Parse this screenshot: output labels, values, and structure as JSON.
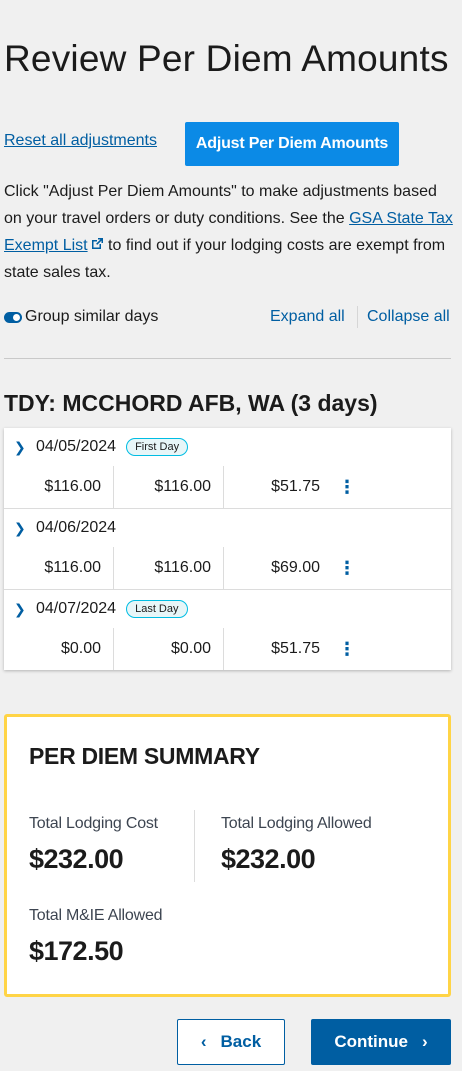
{
  "page": {
    "title": "Review Per Diem Amounts"
  },
  "actions": {
    "reset_label": "Reset all adjustments",
    "adjust_label": "Adjust Per Diem Amounts"
  },
  "intro": {
    "text_before": "Click \"Adjust Per Diem Amounts\" to make adjustments based on your travel orders or duty conditions. See the ",
    "link_text": "GSA State Tax Exempt List",
    "text_after": " to find out if your lodging costs are exempt from state sales tax."
  },
  "controls": {
    "group_label": "Group similar days",
    "group_enabled": true,
    "expand_all": "Expand all",
    "collapse_all": "Collapse all"
  },
  "tdy": {
    "heading": "TDY: MCCHORD AFB, WA (3 days)",
    "days": [
      {
        "date": "04/05/2024",
        "badge": "First Day",
        "v1": "$116.00",
        "v2": "$116.00",
        "v3": "$51.75"
      },
      {
        "date": "04/06/2024",
        "badge": "",
        "v1": "$116.00",
        "v2": "$116.00",
        "v3": "$69.00"
      },
      {
        "date": "04/07/2024",
        "badge": "Last Day",
        "v1": "$0.00",
        "v2": "$0.00",
        "v3": "$51.75"
      }
    ]
  },
  "summary": {
    "title": "PER DIEM SUMMARY",
    "lodging_cost_label": "Total Lodging Cost",
    "lodging_cost_value": "$232.00",
    "lodging_allowed_label": "Total Lodging Allowed",
    "lodging_allowed_value": "$232.00",
    "mie_label": "Total M&IE Allowed",
    "mie_value": "$172.50"
  },
  "footer": {
    "back_label": "Back",
    "continue_label": "Continue"
  },
  "colors": {
    "primary": "#005ea2",
    "adjust_button": "#0b8ae6",
    "summary_border": "#ffd446"
  }
}
